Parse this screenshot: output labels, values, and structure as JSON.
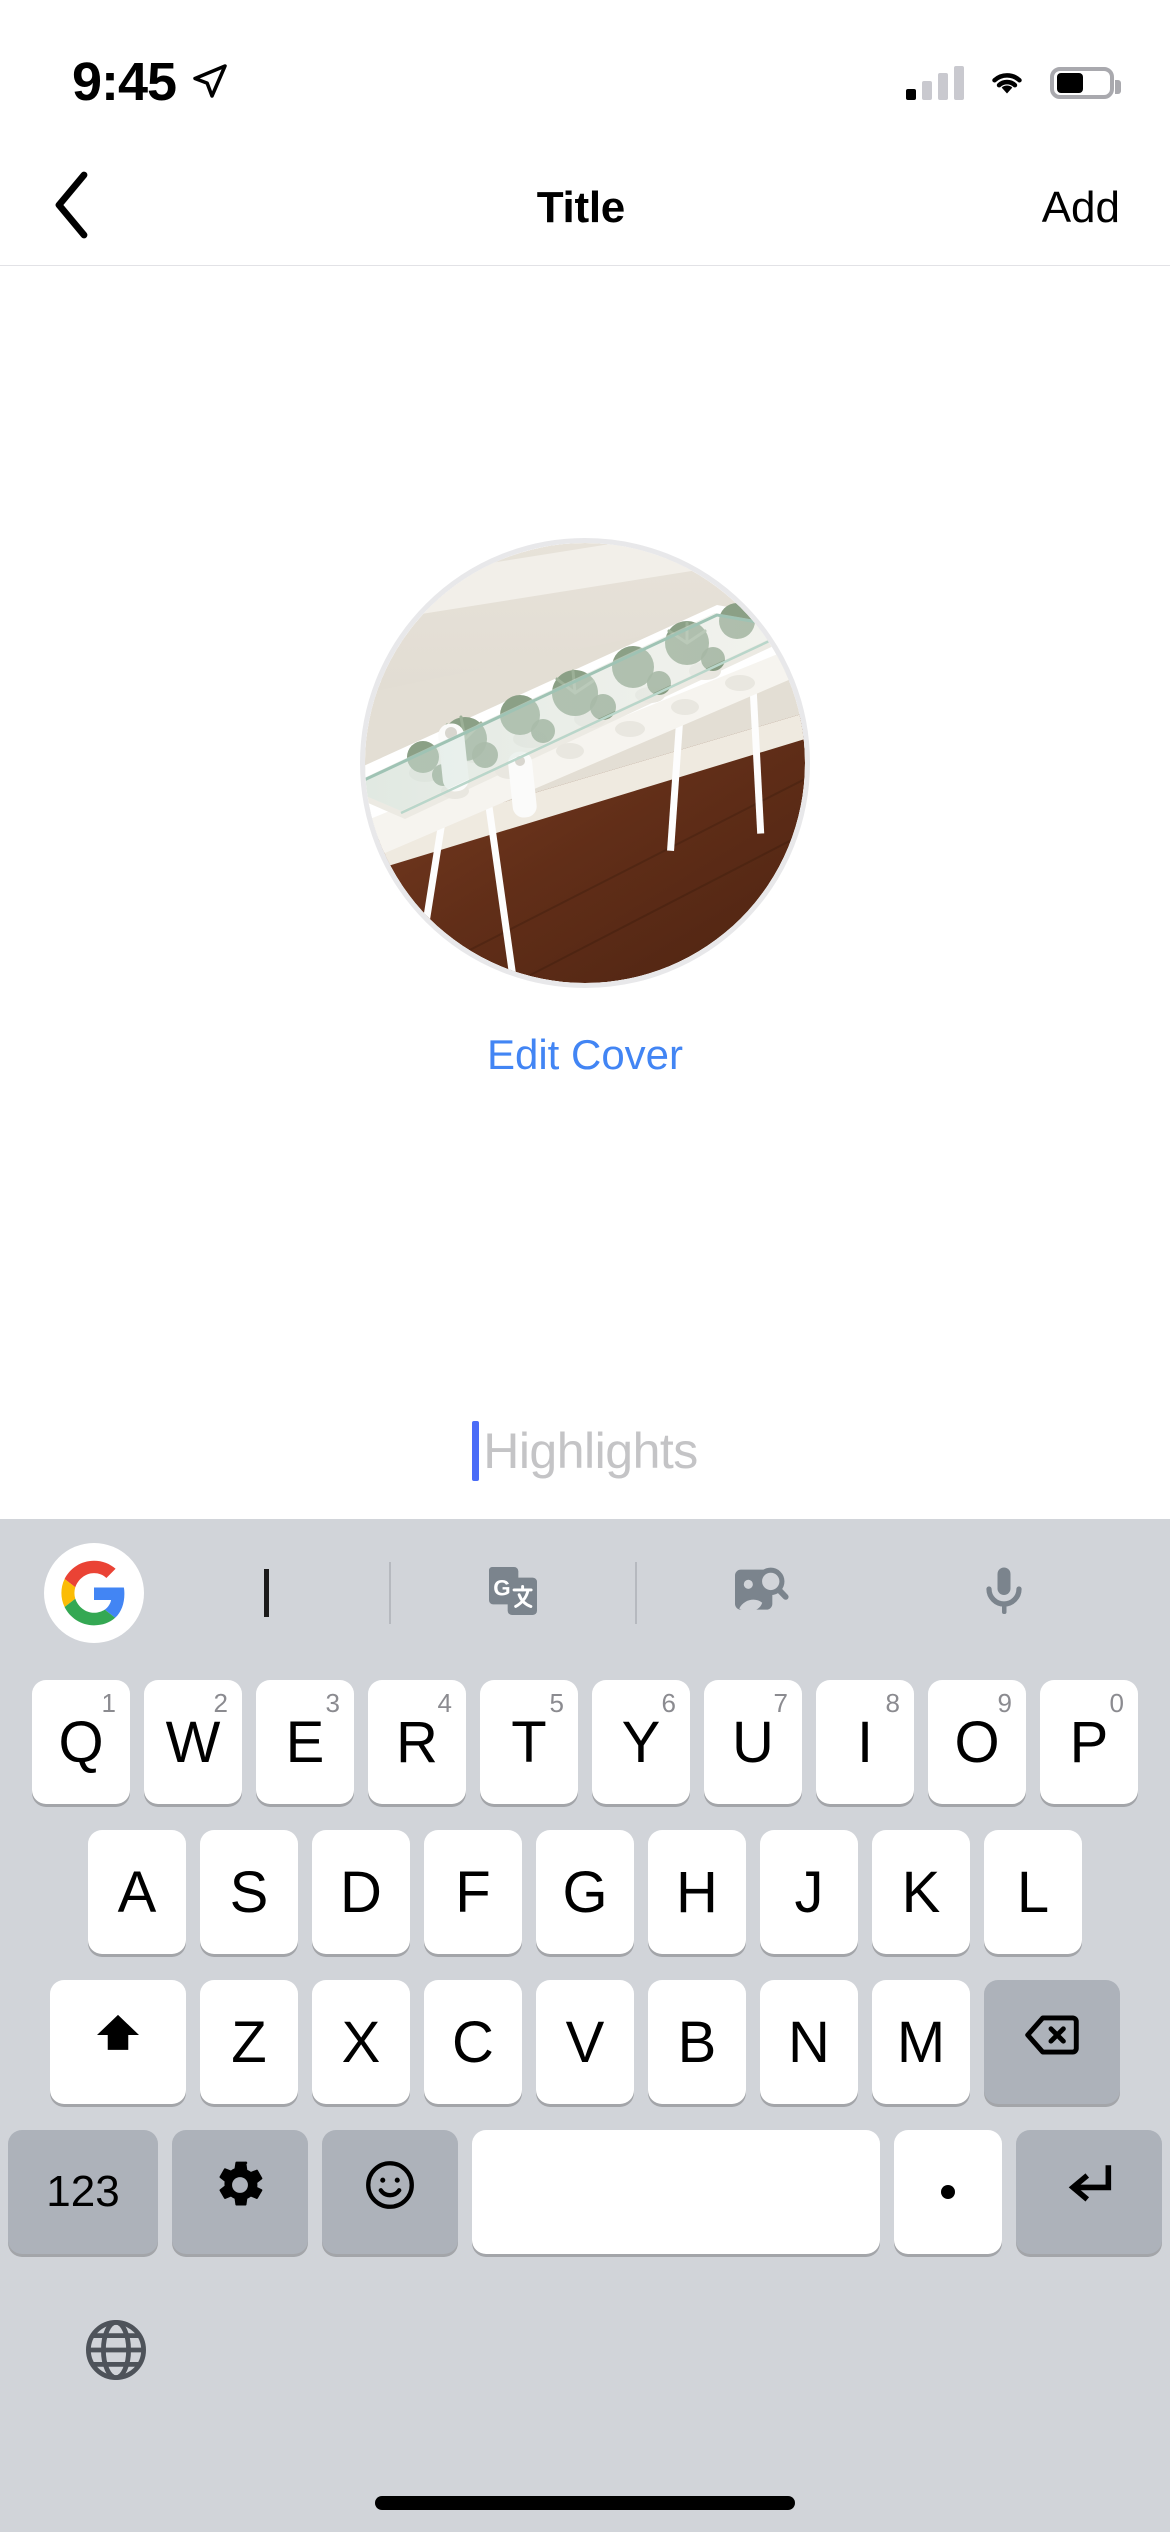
{
  "status_bar": {
    "time": "9:45",
    "location_icon": "location-arrow-icon",
    "signal_icon": "cellular-signal-icon",
    "signal_bars_active": 1,
    "signal_bars_total": 4,
    "wifi_icon": "wifi-icon",
    "battery_icon": "battery-icon",
    "battery_level_percent": 45
  },
  "navbar": {
    "back_icon": "chevron-left-icon",
    "title": "Title",
    "add_label": "Add"
  },
  "content": {
    "cover_image_alt": "succulent-terrarium-table-photo",
    "edit_cover_label": "Edit Cover",
    "edit_cover_color": "#4285f4",
    "title_input": {
      "value": "",
      "placeholder": "Highlights",
      "caret_color": "#4a6cf7"
    }
  },
  "keyboard": {
    "background_color": "#d1d4d9",
    "toolbar": {
      "google_logo": "google-g-logo-icon",
      "clipboard_icon": "text-cursor-icon",
      "translate_icon": "google-translate-icon",
      "image_search_icon": "sticker-image-search-icon",
      "mic_icon": "microphone-icon"
    },
    "row1": [
      {
        "label": "Q",
        "num": "1"
      },
      {
        "label": "W",
        "num": "2"
      },
      {
        "label": "E",
        "num": "3"
      },
      {
        "label": "R",
        "num": "4"
      },
      {
        "label": "T",
        "num": "5"
      },
      {
        "label": "Y",
        "num": "6"
      },
      {
        "label": "U",
        "num": "7"
      },
      {
        "label": "I",
        "num": "8"
      },
      {
        "label": "O",
        "num": "9"
      },
      {
        "label": "P",
        "num": "0"
      }
    ],
    "row2": [
      {
        "label": "A"
      },
      {
        "label": "S"
      },
      {
        "label": "D"
      },
      {
        "label": "F"
      },
      {
        "label": "G"
      },
      {
        "label": "H"
      },
      {
        "label": "J"
      },
      {
        "label": "K"
      },
      {
        "label": "L"
      }
    ],
    "row3": [
      {
        "label": "Z"
      },
      {
        "label": "X"
      },
      {
        "label": "C"
      },
      {
        "label": "V"
      },
      {
        "label": "B"
      },
      {
        "label": "N"
      },
      {
        "label": "M"
      }
    ],
    "shift_icon": "shift-arrow-icon",
    "backspace_icon": "backspace-delete-icon",
    "numeric_label": "123",
    "settings_icon": "gear-icon",
    "emoji_icon": "smiley-face-icon",
    "space_label": "",
    "period_label": ".",
    "enter_icon": "return-enter-icon",
    "globe_icon": "globe-language-icon"
  },
  "home_indicator": "home-indicator"
}
